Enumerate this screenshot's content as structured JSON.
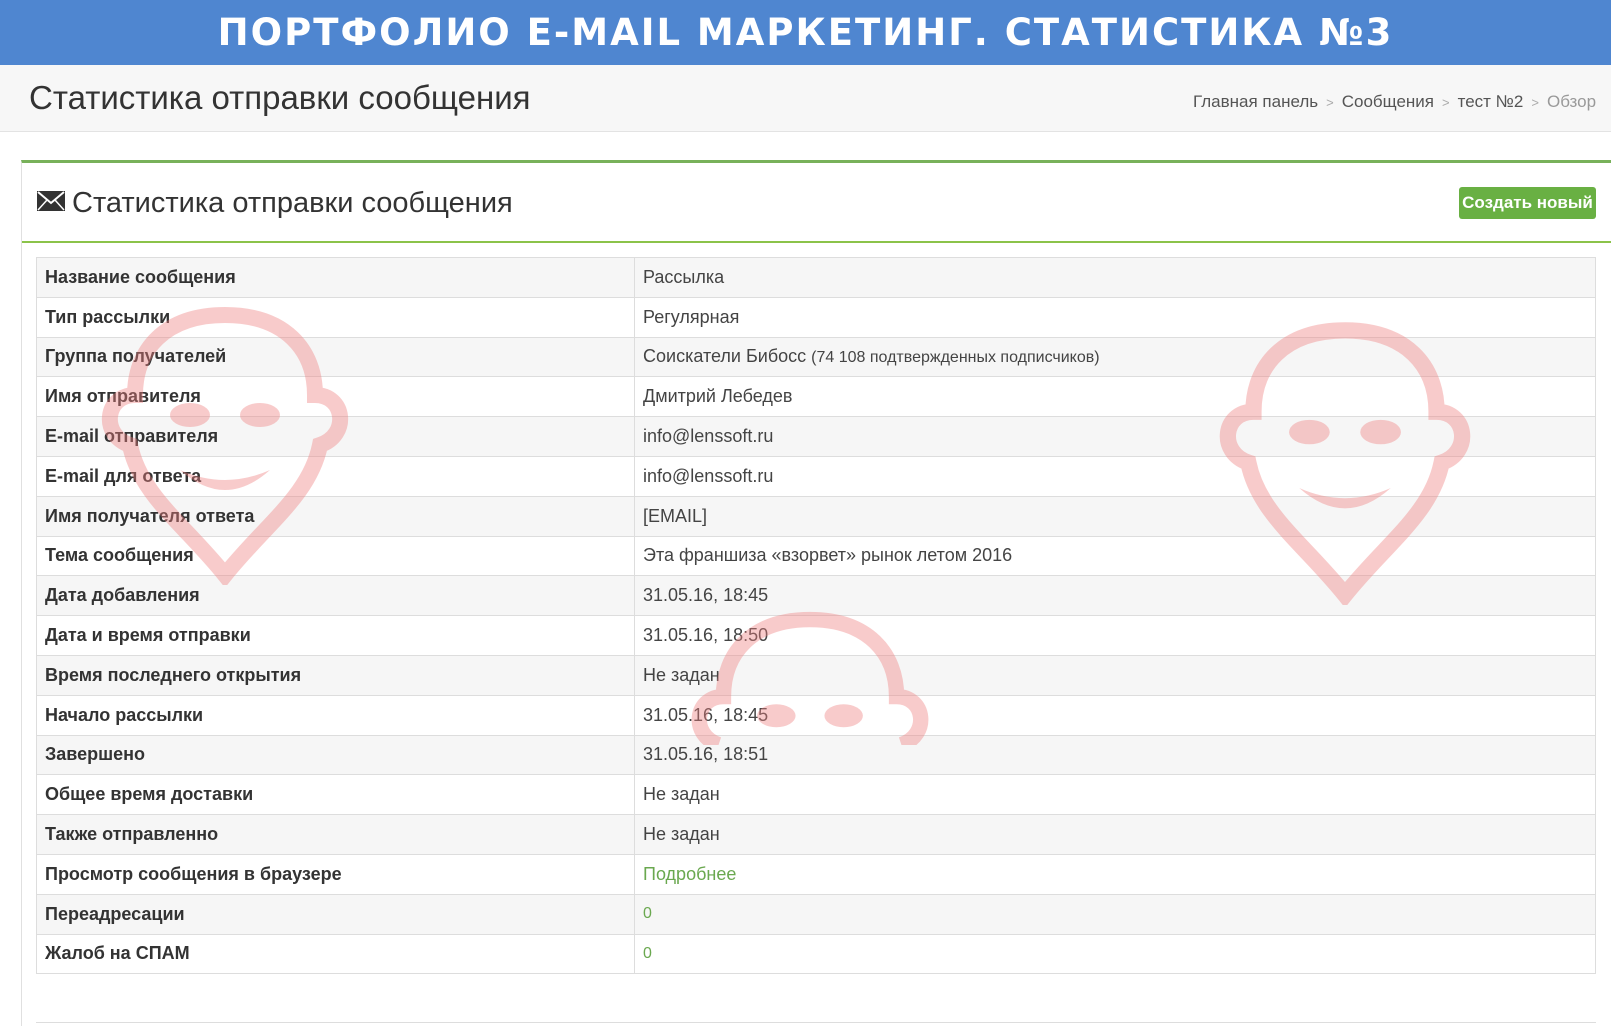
{
  "banner": {
    "title": "ПОРТФОЛИО E-MAIL МАРКЕТИНГ. СТАТИСТИКА №3"
  },
  "header": {
    "title": "Статистика отправки сообщения",
    "breadcrumb": [
      "Главная панель",
      "Сообщения",
      "тест №2",
      "Обзор"
    ]
  },
  "panel": {
    "icon": "envelope-icon",
    "title": "Статистика отправки сообщения",
    "create_button": "Создать новый"
  },
  "rows": [
    {
      "label": "Название сообщения",
      "value": "Рассылка"
    },
    {
      "label": "Тип рассылки",
      "value": "Регулярная"
    },
    {
      "label": "Группа получателей",
      "value_main": "Соискатели Бибосс",
      "value_extra": "(74 108 подтвержденных подписчиков)"
    },
    {
      "label": "Имя отправителя",
      "value": "Дмитрий Лебедев"
    },
    {
      "label": "E-mail отправителя",
      "value": "info@lenssoft.ru"
    },
    {
      "label": "E-mail для ответа",
      "value": "info@lenssoft.ru"
    },
    {
      "label": "Имя получателя ответа",
      "value": "[EMAIL]"
    },
    {
      "label": "Тема сообщения",
      "value": "Эта франшиза «взорвет» рынок летом 2016"
    },
    {
      "label": "Дата добавления",
      "value": "31.05.16, 18:45"
    },
    {
      "label": "Дата и время отправки",
      "value": "31.05.16, 18:50"
    },
    {
      "label": "Время последнего открытия",
      "value": "Не задан"
    },
    {
      "label": "Начало рассылки",
      "value": "31.05.16, 18:45"
    },
    {
      "label": "Завершено",
      "value": "31.05.16, 18:51"
    },
    {
      "label": "Общее время доставки",
      "value": "Не задан"
    },
    {
      "label": "Также отправленно",
      "value": "Не задан"
    },
    {
      "label": "Просмотр сообщения в браузере",
      "value": "Подробнее"
    },
    {
      "label": "Переадресации",
      "value": "0"
    },
    {
      "label": "Жалоб на СПАМ",
      "value": "0"
    }
  ],
  "colors": {
    "banner": "#4f86d0",
    "accent_green": "#69b043",
    "watermark": "#f08080"
  }
}
